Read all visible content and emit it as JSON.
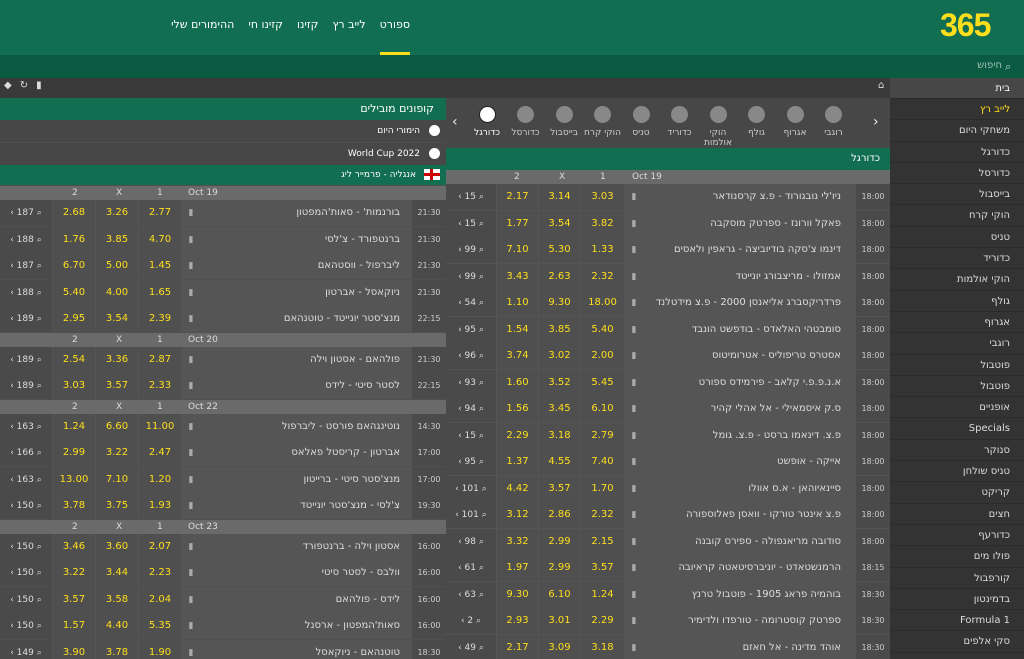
{
  "logo": "365",
  "nav": [
    "ספורט",
    "לייב רץ",
    "קזינו",
    "קזינו חי",
    "ההימורים שלי"
  ],
  "search_placeholder": "חיפוש",
  "sidebar": {
    "home": "בית",
    "live_prefix": "לייב רץ",
    "live_highlight": "לייב רץ",
    "items": [
      "משחקי היום",
      "כדורגל",
      "כדורסל",
      "בייסבול",
      "הוקי קרח",
      "טניס",
      "כדוריד",
      "הוקי אולמות",
      "גולף",
      "אגרוף",
      "רוגבי",
      "פוטבול",
      "פוטבול",
      "אופניים",
      "Specials",
      "סנוקר",
      "טניס שולחן",
      "קריקט",
      "חצים",
      "כדורעף",
      "פולו מים",
      "קורפבול",
      "בדמינטון",
      "Formula 1",
      "סקי אלפים"
    ]
  },
  "sports": [
    {
      "label": "כדורגל",
      "icon": "soccer-icon",
      "active": true
    },
    {
      "label": "כדורסל",
      "icon": "basketball-icon"
    },
    {
      "label": "בייסבול",
      "icon": "baseball-icon"
    },
    {
      "label": "הוקי קרח",
      "icon": "hockey-icon"
    },
    {
      "label": "טניס",
      "icon": "tennis-icon"
    },
    {
      "label": "כדוריד",
      "icon": "handball-icon"
    },
    {
      "label": "הוקי אולמות",
      "icon": "futsal-icon"
    },
    {
      "label": "גולף",
      "icon": "golf-icon"
    },
    {
      "label": "אגרוף",
      "icon": "boxing-icon"
    },
    {
      "label": "רוגבי",
      "icon": "rugby-icon"
    }
  ],
  "main": {
    "section_title": "כדורגל",
    "date": "Oct 19",
    "col1": "1",
    "colx": "X",
    "col2": "2",
    "rows": [
      {
        "time": "18:00",
        "teams": "ניו'לי נובגורוד - פ.צ קרסנודאר",
        "o1": "3.03",
        "ox": "3.14",
        "o2": "2.17",
        "more": "15"
      },
      {
        "time": "18:00",
        "teams": "פאקל וורונז - ספרטק מוסקבה",
        "o1": "3.82",
        "ox": "3.54",
        "o2": "1.77",
        "more": "15"
      },
      {
        "time": "18:00",
        "teams": "דינמו צ'סקה בודיוביצה - גראפין ולאסים",
        "o1": "1.33",
        "ox": "5.30",
        "o2": "7.10",
        "more": "99"
      },
      {
        "time": "18:00",
        "teams": "אמזולו - מריצבורג יונייטד",
        "o1": "2.32",
        "ox": "2.63",
        "o2": "3.43",
        "more": "99"
      },
      {
        "time": "18:00",
        "teams": "פרדריקסברג אליאנסן 2000 - פ.צ מידטלנד",
        "o1": "18.00",
        "ox": "9.30",
        "o2": "1.10",
        "more": "54"
      },
      {
        "time": "18:00",
        "teams": "סומבטהי האלאדס - בודפשט הונבד",
        "o1": "5.40",
        "ox": "3.85",
        "o2": "1.54",
        "more": "95"
      },
      {
        "time": "18:00",
        "teams": "אסטרס טריפוליס - אטרומיטוס",
        "o1": "2.00",
        "ox": "3.02",
        "o2": "3.74",
        "more": "96"
      },
      {
        "time": "18:00",
        "teams": "א.נ.פ.פ.י קלאב - פירמידס ספורט",
        "o1": "5.45",
        "ox": "3.52",
        "o2": "1.60",
        "more": "93"
      },
      {
        "time": "18:00",
        "teams": "ס.ק איסמאילי - אל אהלי קהיר",
        "o1": "6.10",
        "ox": "3.45",
        "o2": "1.56",
        "more": "94"
      },
      {
        "time": "18:00",
        "teams": "פ.צ. דינאמו ברסט - פ.צ. גומל",
        "o1": "2.79",
        "ox": "3.18",
        "o2": "2.29",
        "more": "15"
      },
      {
        "time": "18:00",
        "teams": "אייקה - אופשט",
        "o1": "7.40",
        "ox": "4.55",
        "o2": "1.37",
        "more": "95"
      },
      {
        "time": "18:00",
        "teams": "סיינאיוהאן - א.ס אוולו",
        "o1": "1.70",
        "ox": "3.57",
        "o2": "4.42",
        "more": "101"
      },
      {
        "time": "18:00",
        "teams": "פ.צ אינטר טורקו - וואסן פאלוספורה",
        "o1": "2.32",
        "ox": "2.86",
        "o2": "3.12",
        "more": "101"
      },
      {
        "time": "18:00",
        "teams": "סודובה מריאנפולה - ספירס קובנה",
        "o1": "2.15",
        "ox": "2.99",
        "o2": "3.32",
        "more": "98"
      },
      {
        "time": "18:15",
        "teams": "הרמנשטאדט - יוניברסיטאטה קראיובה",
        "o1": "3.57",
        "ox": "2.99",
        "o2": "1.97",
        "more": "61"
      },
      {
        "time": "18:30",
        "teams": "בוהמיה פראג 1905 - פוטבול טרנץ",
        "o1": "1.24",
        "ox": "6.10",
        "o2": "9.30",
        "more": "63"
      },
      {
        "time": "18:30",
        "teams": "ספרטק קוסטרומה - טורפדו ולדימיר",
        "o1": "2.29",
        "ox": "3.01",
        "o2": "2.93",
        "more": "2"
      },
      {
        "time": "18:30",
        "teams": "אוהד מדינה - אל חאזם",
        "o1": "3.18",
        "ox": "3.09",
        "o2": "2.17",
        "more": "49"
      }
    ]
  },
  "coupons": {
    "title": "קופונים מובילים",
    "items": [
      "הימורי היום",
      "World Cup 2022"
    ],
    "league": "אנגליה - פרמייר ליג",
    "groups": [
      {
        "date": "Oct 19",
        "col1": "1",
        "colx": "X",
        "col2": "2",
        "rows": [
          {
            "time": "21:30",
            "teams": "בורנמות' - סאות'המפטון",
            "o1": "2.77",
            "ox": "3.26",
            "o2": "2.68",
            "more": "187"
          },
          {
            "time": "21:30",
            "teams": "ברנטפורד - צ'לסי",
            "o1": "4.70",
            "ox": "3.85",
            "o2": "1.76",
            "more": "188"
          },
          {
            "time": "21:30",
            "teams": "ליברפול - ווסטהאם",
            "o1": "1.45",
            "ox": "5.00",
            "o2": "6.70",
            "more": "187"
          },
          {
            "time": "21:30",
            "teams": "ניוקאסל - אברטון",
            "o1": "1.65",
            "ox": "4.00",
            "o2": "5.40",
            "more": "188"
          },
          {
            "time": "22:15",
            "teams": "מנצ'סטר יונייטד - טוטנהאם",
            "o1": "2.39",
            "ox": "3.54",
            "o2": "2.95",
            "more": "189"
          }
        ]
      },
      {
        "date": "Oct 20",
        "col1": "1",
        "colx": "X",
        "col2": "2",
        "rows": [
          {
            "time": "21:30",
            "teams": "פולהאם - אסטון וילה",
            "o1": "2.87",
            "ox": "3.36",
            "o2": "2.54",
            "more": "189"
          },
          {
            "time": "22:15",
            "teams": "לסטר סיטי - לידס",
            "o1": "2.33",
            "ox": "3.57",
            "o2": "3.03",
            "more": "189"
          }
        ]
      },
      {
        "date": "Oct 22",
        "col1": "1",
        "colx": "X",
        "col2": "2",
        "rows": [
          {
            "time": "14:30",
            "teams": "נוטינגהאם פורסט - ליברפול",
            "o1": "11.00",
            "ox": "6.60",
            "o2": "1.24",
            "more": "163"
          },
          {
            "time": "17:00",
            "teams": "אברטון - קריסטל פאלאס",
            "o1": "2.47",
            "ox": "3.22",
            "o2": "2.99",
            "more": "166"
          },
          {
            "time": "17:00",
            "teams": "מנצ'סטר סיטי - ברייטון",
            "o1": "1.20",
            "ox": "7.10",
            "o2": "13.00",
            "more": "163"
          },
          {
            "time": "19:30",
            "teams": "צ'לסי - מנצ'סטר יונייטד",
            "o1": "1.93",
            "ox": "3.75",
            "o2": "3.78",
            "more": "150"
          }
        ]
      },
      {
        "date": "Oct 23",
        "col1": "1",
        "colx": "X",
        "col2": "2",
        "rows": [
          {
            "time": "16:00",
            "teams": "אסטון וילה - ברנטפורד",
            "o1": "2.07",
            "ox": "3.60",
            "o2": "3.46",
            "more": "150"
          },
          {
            "time": "16:00",
            "teams": "וולבס - לסטר סיטי",
            "o1": "2.23",
            "ox": "3.44",
            "o2": "3.22",
            "more": "150"
          },
          {
            "time": "16:00",
            "teams": "לידס - פולהאם",
            "o1": "2.04",
            "ox": "3.58",
            "o2": "3.57",
            "more": "150"
          },
          {
            "time": "16:00",
            "teams": "סאות'המפטון - ארסנל",
            "o1": "5.35",
            "ox": "4.40",
            "o2": "1.57",
            "more": "150"
          },
          {
            "time": "18:30",
            "teams": "טוטנהאם - ניוקאסל",
            "o1": "1.90",
            "ox": "3.78",
            "o2": "3.90",
            "more": "149"
          }
        ]
      }
    ]
  }
}
